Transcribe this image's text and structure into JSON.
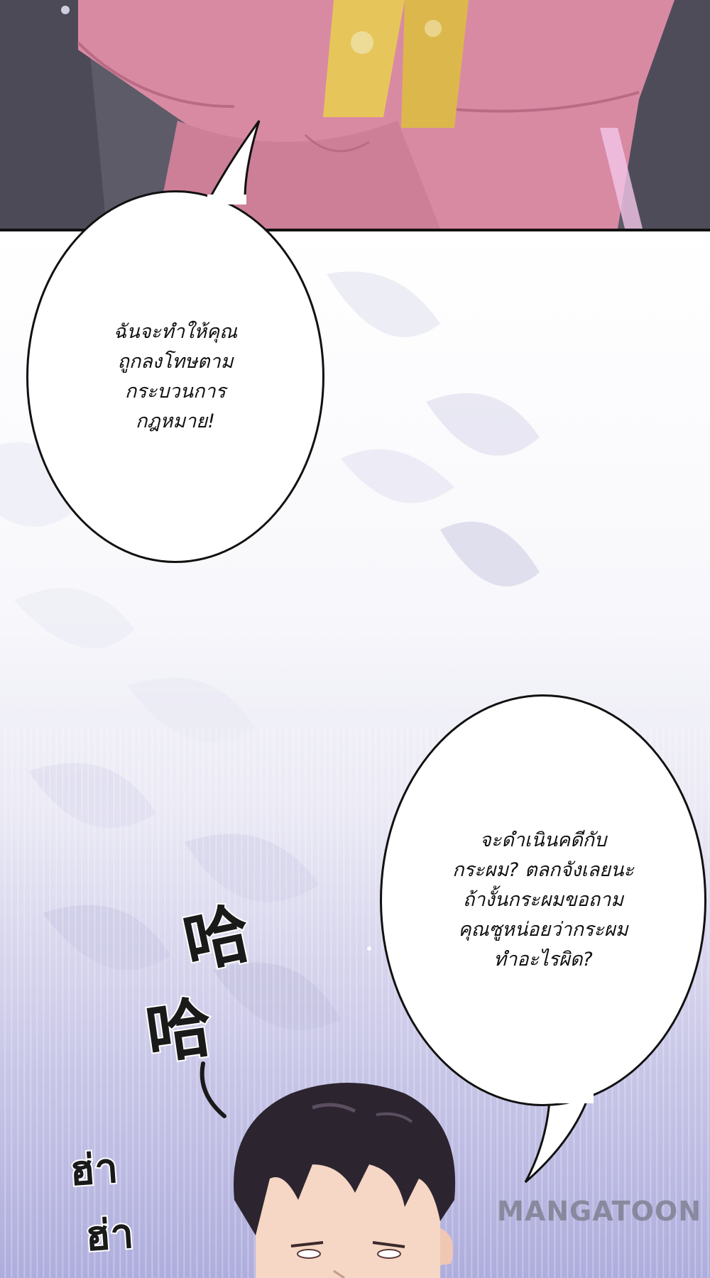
{
  "top_panel": {
    "scene": "pink-robe-figure"
  },
  "bubbles": [
    {
      "text": "ฉันจะทำให้คุณ\nถูกลงโทษตาม\nกระบวนการ\nกฎหมาย!"
    },
    {
      "text": "จะดำเนินคดีกับ\nกระผม? ตลกจังเลยนะ\nถ้างั้นกระผมขอถาม\nคุณซูหน่อยว่ากระผม\nทำอะไรผิด?"
    }
  ],
  "sfx": {
    "ha1": "哈",
    "ha2": "哈",
    "ha_thai_1": "ฮ่า",
    "ha_thai_2": "ฮ่า"
  },
  "watermark": "MANGATOON",
  "colors": {
    "robe": "#d98aa3",
    "sash": "#e6c65a",
    "hair": "#2c2530",
    "skin": "#f6d6c4"
  }
}
